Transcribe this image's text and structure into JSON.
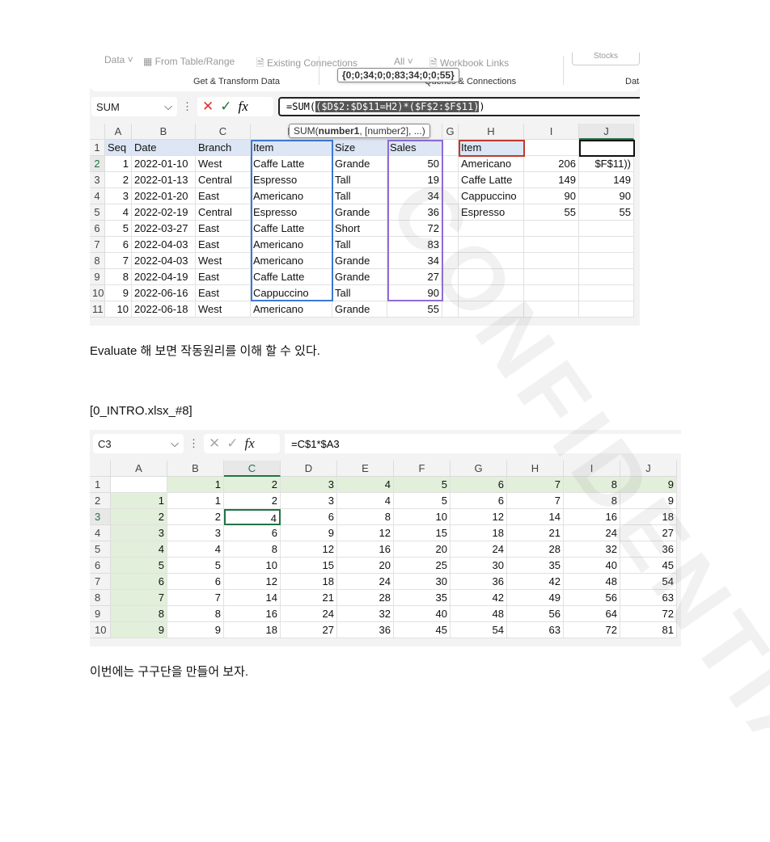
{
  "shot1": {
    "ribbon": {
      "items": [
        "Data ˅",
        "From Table/Range",
        "Existing Connections",
        "All ˅",
        "Workbook Links"
      ],
      "group_labels": [
        "Get & Transform Data",
        "Queries & Connections",
        "Data"
      ],
      "stocks": "Stocks"
    },
    "array_tooltip": "{0;0;34;0;0;83;34;0;0;55}",
    "name_box": "SUM",
    "formula_prefix": "=SUM(",
    "formula_selected": "($D$2:$D$11=H2)*($F$2:$F$11)",
    "formula_suffix": ")",
    "func_tooltip_name": "SUM(",
    "func_tooltip_bold": "number1",
    "func_tooltip_rest": ", [number2], ...)",
    "columns": [
      "A",
      "B",
      "C",
      "D",
      "E",
      "F",
      "G",
      "H",
      "I",
      "J"
    ],
    "rows": [
      [
        "Seq",
        "Date",
        "Branch",
        "Item",
        "Size",
        "Sales",
        "",
        "Item",
        "",
        ""
      ],
      [
        "1",
        "2022-01-10",
        "West",
        "Caffe Latte",
        "Grande",
        "50",
        "",
        "Americano",
        "206",
        "$F$11))"
      ],
      [
        "2",
        "2022-01-13",
        "Central",
        "Espresso",
        "Tall",
        "19",
        "",
        "Caffe Latte",
        "149",
        "149"
      ],
      [
        "3",
        "2022-01-20",
        "East",
        "Americano",
        "Tall",
        "34",
        "",
        "Cappuccino",
        "90",
        "90"
      ],
      [
        "4",
        "2022-02-19",
        "Central",
        "Espresso",
        "Grande",
        "36",
        "",
        "Espresso",
        "55",
        "55"
      ],
      [
        "5",
        "2022-03-27",
        "East",
        "Caffe Latte",
        "Short",
        "72",
        "",
        "",
        "",
        ""
      ],
      [
        "6",
        "2022-04-03",
        "East",
        "Americano",
        "Tall",
        "83",
        "",
        "",
        "",
        ""
      ],
      [
        "7",
        "2022-04-03",
        "West",
        "Americano",
        "Grande",
        "34",
        "",
        "",
        "",
        ""
      ],
      [
        "8",
        "2022-04-19",
        "East",
        "Caffe Latte",
        "Grande",
        "27",
        "",
        "",
        "",
        ""
      ],
      [
        "9",
        "2022-06-16",
        "East",
        "Cappuccino",
        "Tall",
        "90",
        "",
        "",
        "",
        ""
      ],
      [
        "10",
        "2022-06-18",
        "West",
        "Americano",
        "Grande",
        "55",
        "",
        "",
        "",
        ""
      ]
    ]
  },
  "para1": "Evaluate 해 보면 작동원리를 이해 할 수 있다.",
  "para2": "[0_INTRO.xlsx_#8]",
  "shot2": {
    "name_box": "C3",
    "formula": "=C$1*$A3",
    "columns": [
      "A",
      "B",
      "C",
      "D",
      "E",
      "F",
      "G",
      "H",
      "I",
      "J"
    ],
    "rows": [
      [
        "",
        "1",
        "2",
        "3",
        "4",
        "5",
        "6",
        "7",
        "8",
        "9"
      ],
      [
        "1",
        "1",
        "2",
        "3",
        "4",
        "5",
        "6",
        "7",
        "8",
        "9"
      ],
      [
        "2",
        "2",
        "4",
        "6",
        "8",
        "10",
        "12",
        "14",
        "16",
        "18"
      ],
      [
        "3",
        "3",
        "6",
        "9",
        "12",
        "15",
        "18",
        "21",
        "24",
        "27"
      ],
      [
        "4",
        "4",
        "8",
        "12",
        "16",
        "20",
        "24",
        "28",
        "32",
        "36"
      ],
      [
        "5",
        "5",
        "10",
        "15",
        "20",
        "25",
        "30",
        "35",
        "40",
        "45"
      ],
      [
        "6",
        "6",
        "12",
        "18",
        "24",
        "30",
        "36",
        "42",
        "48",
        "54"
      ],
      [
        "7",
        "7",
        "14",
        "21",
        "28",
        "35",
        "42",
        "49",
        "56",
        "63"
      ],
      [
        "8",
        "8",
        "16",
        "24",
        "32",
        "40",
        "48",
        "56",
        "64",
        "72"
      ],
      [
        "9",
        "9",
        "18",
        "27",
        "36",
        "45",
        "54",
        "63",
        "72",
        "81"
      ]
    ]
  },
  "para3": "이번에는 구구단을 만들어 보자.",
  "colors": {
    "accent": "#217346",
    "header_green": "#e2efda",
    "sel_blue": "#3c78d8",
    "sel_purple": "#8e6bd8",
    "sel_red": "#c0392b"
  }
}
